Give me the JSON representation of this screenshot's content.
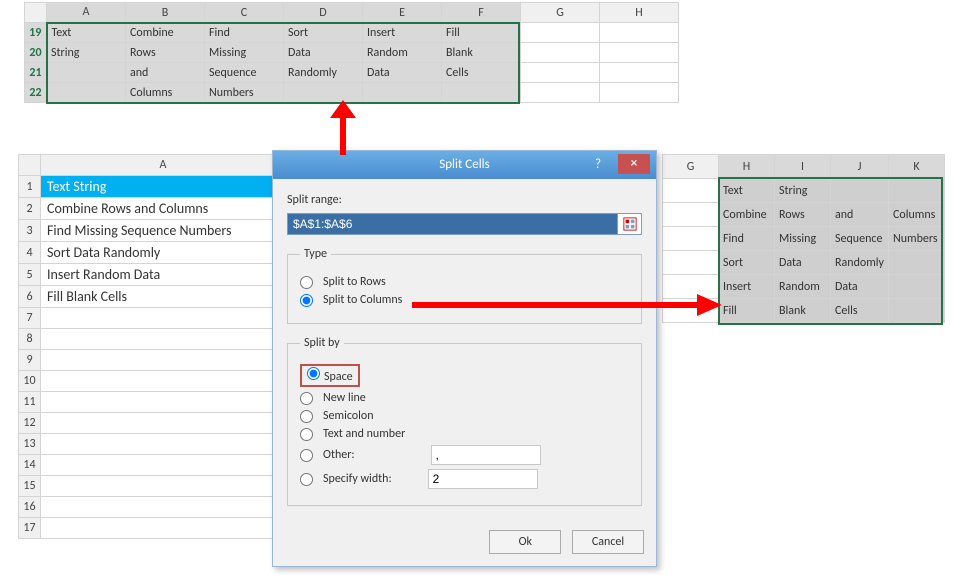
{
  "top_grid": {
    "columns": [
      "A",
      "B",
      "C",
      "D",
      "E",
      "F",
      "G",
      "H"
    ],
    "rows": [
      "19",
      "20",
      "21",
      "22"
    ],
    "data": [
      [
        "Text",
        "Combine",
        "Find",
        "Sort",
        "Insert",
        "Fill",
        "",
        ""
      ],
      [
        "String",
        "Rows",
        "Missing",
        "Data",
        "Random",
        "Blank",
        "",
        ""
      ],
      [
        "",
        "and",
        "Sequence",
        "Randomly",
        "Data",
        "Cells",
        "",
        ""
      ],
      [
        "",
        "Columns",
        "Numbers",
        "",
        "",
        "",
        "",
        ""
      ]
    ]
  },
  "left_grid": {
    "col": "A",
    "rows": [
      "1",
      "2",
      "3",
      "4",
      "5",
      "6",
      "7",
      "8",
      "9",
      "10",
      "11",
      "12",
      "13",
      "14",
      "15",
      "16",
      "17"
    ],
    "data": [
      "Text String",
      "Combine Rows and Columns",
      "Find Missing Sequence Numbers",
      "Sort Data Randomly",
      "Insert Random Data",
      "Fill Blank Cells",
      "",
      "",
      "",
      "",
      "",
      "",
      "",
      "",
      "",
      "",
      ""
    ]
  },
  "right_grid": {
    "columns": [
      "G",
      "H",
      "I",
      "J",
      "K"
    ],
    "data": [
      [
        "",
        "Text",
        "String",
        "",
        ""
      ],
      [
        "",
        "Combine",
        "Rows",
        "and",
        "Columns"
      ],
      [
        "",
        "Find",
        "Missing",
        "Sequence",
        "Numbers"
      ],
      [
        "",
        "Sort",
        "Data",
        "Randomly",
        ""
      ],
      [
        "",
        "Insert",
        "Random",
        "Data",
        ""
      ],
      [
        "",
        "Fill",
        "Blank",
        "Cells",
        ""
      ]
    ]
  },
  "dialog": {
    "title": "Split Cells",
    "help": "?",
    "close": "×",
    "split_range_label": "Split range:",
    "split_range_value": "$A$1:$A$6",
    "type_legend": "Type",
    "type_rows": "Split to Rows",
    "type_cols": "Split to Columns",
    "splitby_legend": "Split by",
    "by_space": "Space",
    "by_newline": "New line",
    "by_semicolon": "Semicolon",
    "by_textnum": "Text and number",
    "by_other": "Other:",
    "by_other_value": ",",
    "by_width": "Specify width:",
    "by_width_value": "2",
    "ok": "Ok",
    "cancel": "Cancel"
  }
}
